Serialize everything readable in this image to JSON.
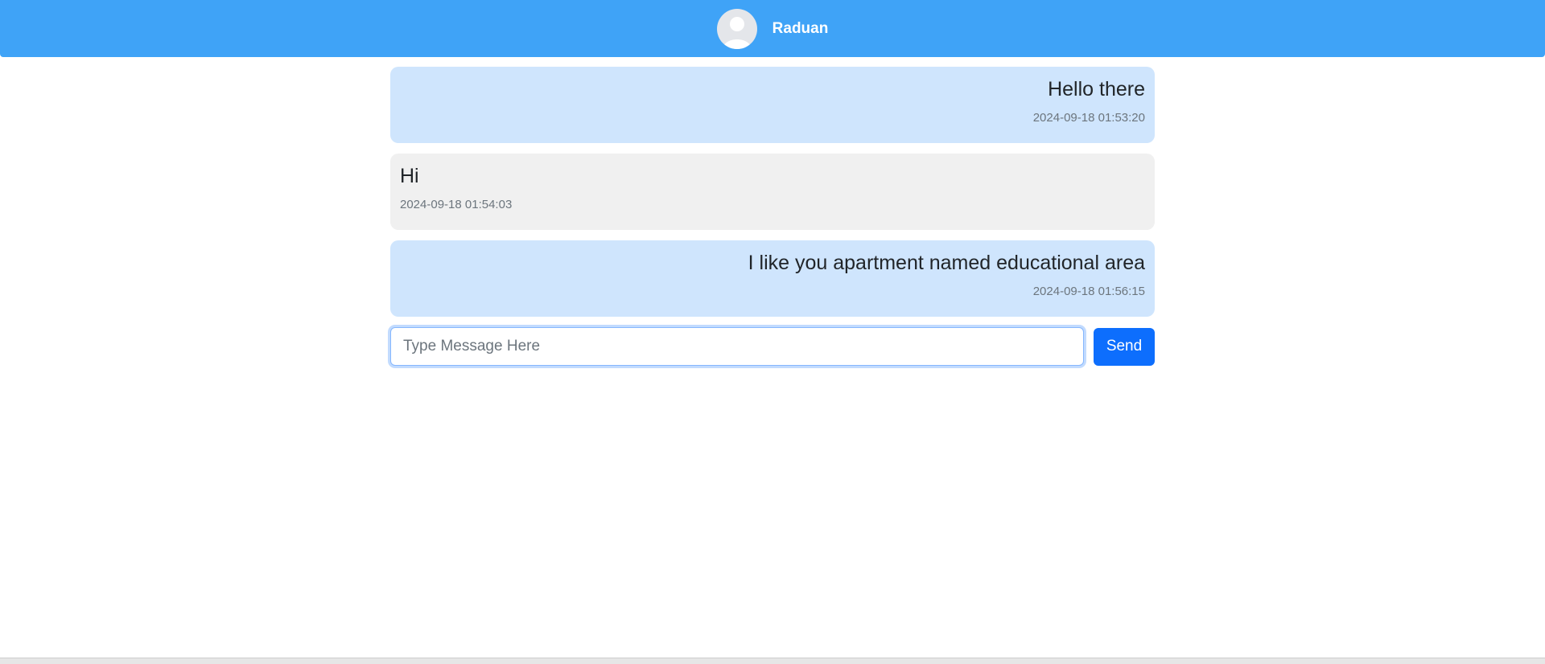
{
  "header": {
    "contact_name": "Raduan",
    "avatar_icon": "user-avatar-icon",
    "background_color": "#3fa3f7"
  },
  "messages": [
    {
      "direction": "sent",
      "text": "Hello there",
      "time": "2024-09-18 01:53:20"
    },
    {
      "direction": "received",
      "text": "Hi",
      "time": "2024-09-18 01:54:03"
    },
    {
      "direction": "sent",
      "text": "I like you apartment named educational area",
      "time": "2024-09-18 01:56:15"
    }
  ],
  "composer": {
    "value": "",
    "placeholder": "Type Message Here",
    "send_label": "Send"
  },
  "colors": {
    "sent_bubble": "#cfe5fd",
    "received_bubble": "#f0f0f0",
    "send_button": "#0d6efd"
  }
}
